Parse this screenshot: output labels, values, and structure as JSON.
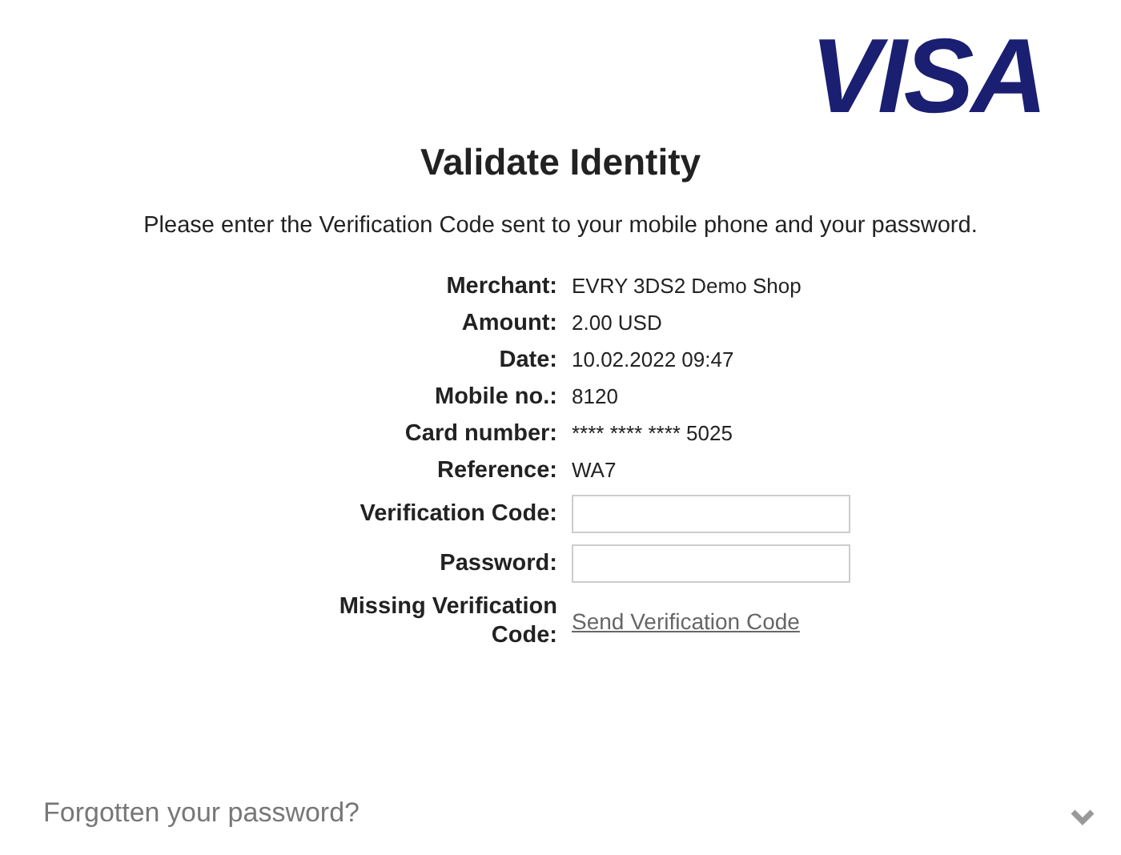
{
  "logo": "VISA",
  "title": "Validate Identity",
  "instruction": "Please enter the Verification Code sent to your mobile phone and your password.",
  "fields": [
    {
      "kind": "text",
      "label": "Merchant:",
      "value": "EVRY 3DS2 Demo Shop"
    },
    {
      "kind": "text",
      "label": "Amount:",
      "value": "2.00 USD"
    },
    {
      "kind": "text",
      "label": "Date:",
      "value": "10.02.2022 09:47"
    },
    {
      "kind": "text",
      "label": "Mobile no.:",
      "value": "8120"
    },
    {
      "kind": "text",
      "label": "Card number:",
      "value": "**** **** **** 5025"
    },
    {
      "kind": "text",
      "label": "Reference:",
      "value": "WA7"
    },
    {
      "kind": "input",
      "label": "Verification Code:"
    },
    {
      "kind": "input",
      "label": "Password:"
    },
    {
      "kind": "link",
      "label": "Missing Verification Code:",
      "value": "Send Verification Code"
    }
  ],
  "footer": {
    "label": "Forgotten your password?",
    "expanded": false
  }
}
